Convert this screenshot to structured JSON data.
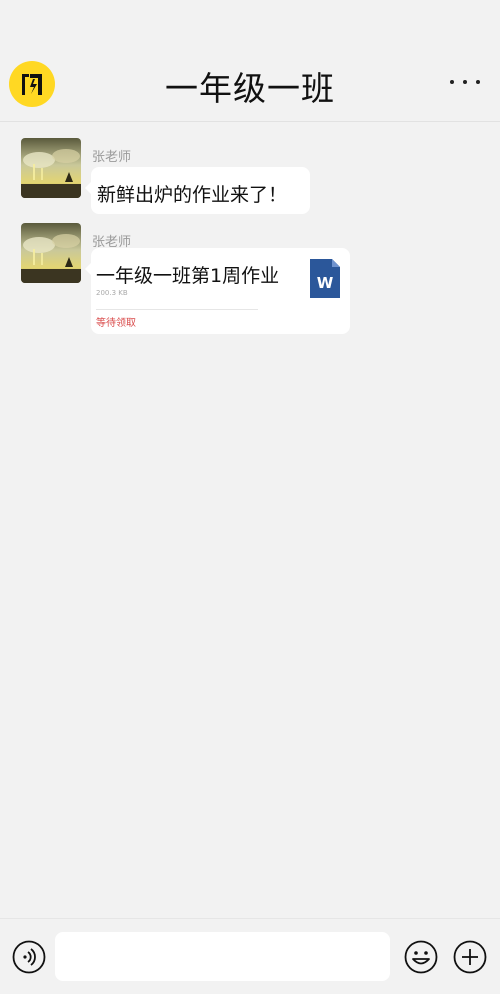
{
  "header": {
    "title": "一年级一班",
    "logo_icon": "app-logo-icon",
    "more_icon": "more-dots-icon"
  },
  "messages": [
    {
      "sender": "张老师",
      "type": "text",
      "text": "新鲜出炉的作业来了！"
    },
    {
      "sender": "张老师",
      "type": "file",
      "file_name": "一年级一班第1周作业",
      "file_size": "200.3 KB",
      "status": "等待领取",
      "file_icon": "word-doc-icon",
      "file_icon_letter": "W"
    }
  ],
  "input_bar": {
    "placeholder": "",
    "voice_icon": "voice-icon",
    "emoji_icon": "emoji-icon",
    "add_icon": "add-icon"
  },
  "colors": {
    "background": "#f2f2f2",
    "bubble": "#ffffff",
    "logo": "#ffd823",
    "status_red": "#d94a4a",
    "word_blue": "#2b579a"
  }
}
